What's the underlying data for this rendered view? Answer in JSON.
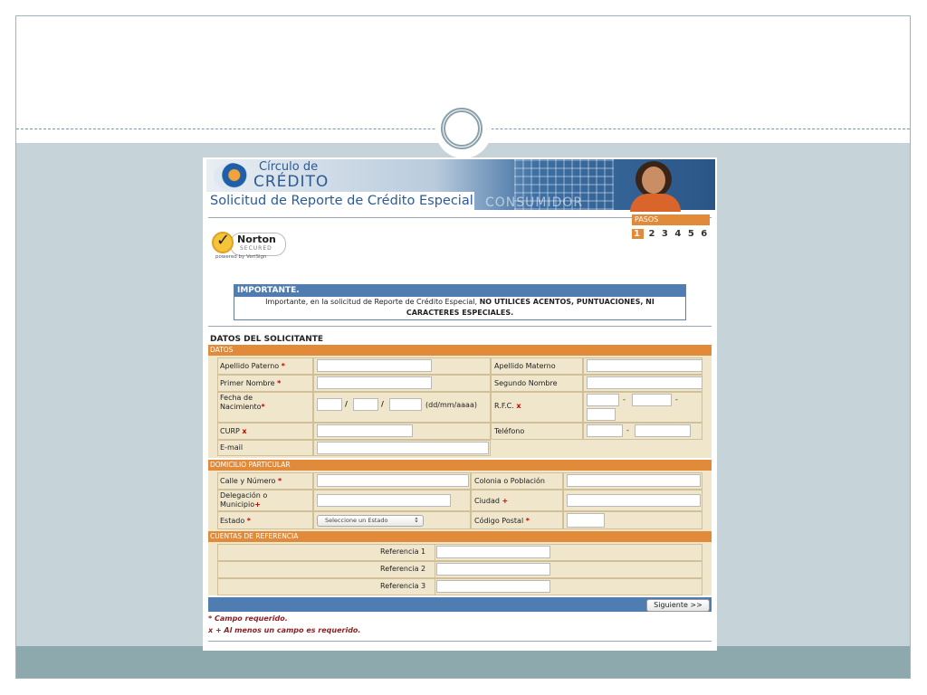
{
  "header": {
    "logo_line1": "Círculo de",
    "logo_line2": "CRÉDITO",
    "title": "Solicitud de Reporte de Crédito Especial",
    "subtitle": "CONSUMIDOR"
  },
  "norton": {
    "brand": "Norton",
    "secured": "SECURED",
    "powered": "powered by VeriSign"
  },
  "pasos": {
    "label": "PASOS",
    "steps": [
      "1",
      "2",
      "3",
      "4",
      "5",
      "6"
    ],
    "active": "1"
  },
  "important": {
    "title": "IMPORTANTE.",
    "text_normal": "Importante, en la solicitud de Reporte de Crédito Especial, ",
    "text_bold": "NO UTILICES ACENTOS, PUNTUACIONES, NI CARACTERES ESPECIALES."
  },
  "section_title": "DATOS DEL SOLICITANTE",
  "datos": {
    "header": "DATOS",
    "apellido_paterno": "Apellido Paterno",
    "apellido_materno": "Apellido Materno",
    "primer_nombre": "Primer Nombre",
    "segundo_nombre": "Segundo Nombre",
    "fecha_line1": "Fecha de",
    "fecha_line2": "Nacimiento",
    "slash": "/",
    "date_hint": "(dd/mm/aaaa)",
    "rfc": "R.F.C.",
    "dash": "-",
    "curp": "CURP",
    "telefono": "Teléfono",
    "email": "E-mail"
  },
  "domicilio": {
    "header": "DOMICILIO PARTICULAR",
    "calle": "Calle y Número",
    "colonia": "Colonia o Población",
    "delegacion_line1": "Delegación o",
    "delegacion_line2": "Municipio",
    "ciudad": "Ciudad",
    "estado": "Estado",
    "estado_value": "Seleccione un Estado",
    "codigo_postal": "Código Postal"
  },
  "cuentas": {
    "header": "CUENTAS DE REFERENCIA",
    "referencias": [
      "Referencia 1",
      "Referencia 2",
      "Referencia 3"
    ]
  },
  "markers": {
    "star": "*",
    "x": "x",
    "plus": "+"
  },
  "actions": {
    "next": "Siguiente >>"
  },
  "notes": {
    "required": "* Campo requerido.",
    "at_least_one": "x + Al menos un campo es requerido."
  }
}
